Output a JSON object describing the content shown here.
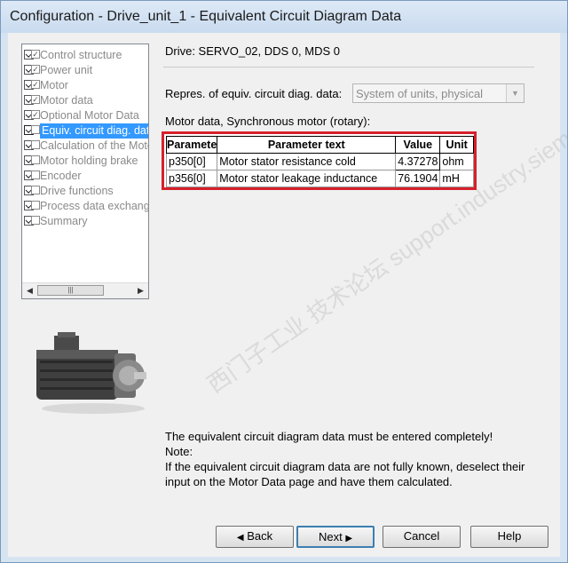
{
  "window": {
    "title": "Configuration - Drive_unit_1 - Equivalent Circuit Diagram Data"
  },
  "nav": {
    "items": [
      {
        "label": "Control structure",
        "checked": true,
        "selected": false
      },
      {
        "label": "Power unit",
        "checked": true,
        "selected": false
      },
      {
        "label": "Motor",
        "checked": true,
        "selected": false
      },
      {
        "label": "Motor data",
        "checked": true,
        "selected": false
      },
      {
        "label": "Optional Motor Data",
        "checked": true,
        "selected": false
      },
      {
        "label": "Equiv. circuit diag. data",
        "checked": false,
        "selected": true
      },
      {
        "label": "Calculation of the Motor",
        "checked": false,
        "selected": false
      },
      {
        "label": "Motor holding brake",
        "checked": false,
        "selected": false
      },
      {
        "label": "Encoder",
        "checked": false,
        "selected": false
      },
      {
        "label": "Drive functions",
        "checked": false,
        "selected": false
      },
      {
        "label": "Process data exchange",
        "checked": false,
        "selected": false
      },
      {
        "label": "Summary",
        "checked": false,
        "selected": false
      }
    ]
  },
  "drive": {
    "label": "Drive: SERVO_02, DDS 0, MDS 0"
  },
  "repres": {
    "label": "Repres. of equiv. circuit diag. data:",
    "value": "System of units, physical"
  },
  "motor_data_label": "Motor data, Synchronous motor (rotary):",
  "table": {
    "headers": [
      "Paramete",
      "Parameter text",
      "Value",
      "Unit"
    ],
    "rows": [
      {
        "param": "p350[0]",
        "text": "Motor stator resistance cold",
        "value": "4.37278",
        "unit": "ohm"
      },
      {
        "param": "p356[0]",
        "text": "Motor stator leakage inductance",
        "value": "76.1904",
        "unit": "mH"
      }
    ]
  },
  "notes": {
    "line1": "The equivalent circuit diagram data must be entered completely!",
    "line2": "Note:",
    "line3": "If the equivalent circuit diagram data are not fully known, deselect their input on the Motor Data page and have them calculated."
  },
  "buttons": {
    "back": "Back",
    "next": "Next",
    "cancel": "Cancel",
    "help": "Help"
  },
  "watermark": "西门子工业 技术论坛 support.industry.siemens.com/cs"
}
